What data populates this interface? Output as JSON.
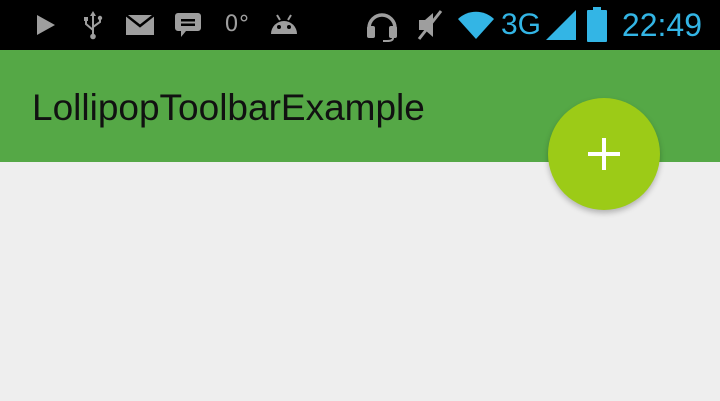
{
  "status_bar": {
    "icons": [
      "play-icon",
      "usb-icon",
      "mail-icon",
      "chat-icon",
      "android-icon",
      "headset-icon",
      "mute-icon",
      "wifi-icon",
      "signal-icon",
      "battery-icon"
    ],
    "temperature": "0°",
    "network_type": "3G",
    "time": "22:49",
    "colors": {
      "active": "#33b5e5",
      "inactive": "#9e9e9e",
      "background": "#000000"
    }
  },
  "toolbar": {
    "title": "LollipopToolbarExample",
    "color": "#55a846"
  },
  "fab": {
    "icon": "plus-icon",
    "color": "#9ccb17"
  },
  "content": {
    "background": "#eeeeee"
  }
}
